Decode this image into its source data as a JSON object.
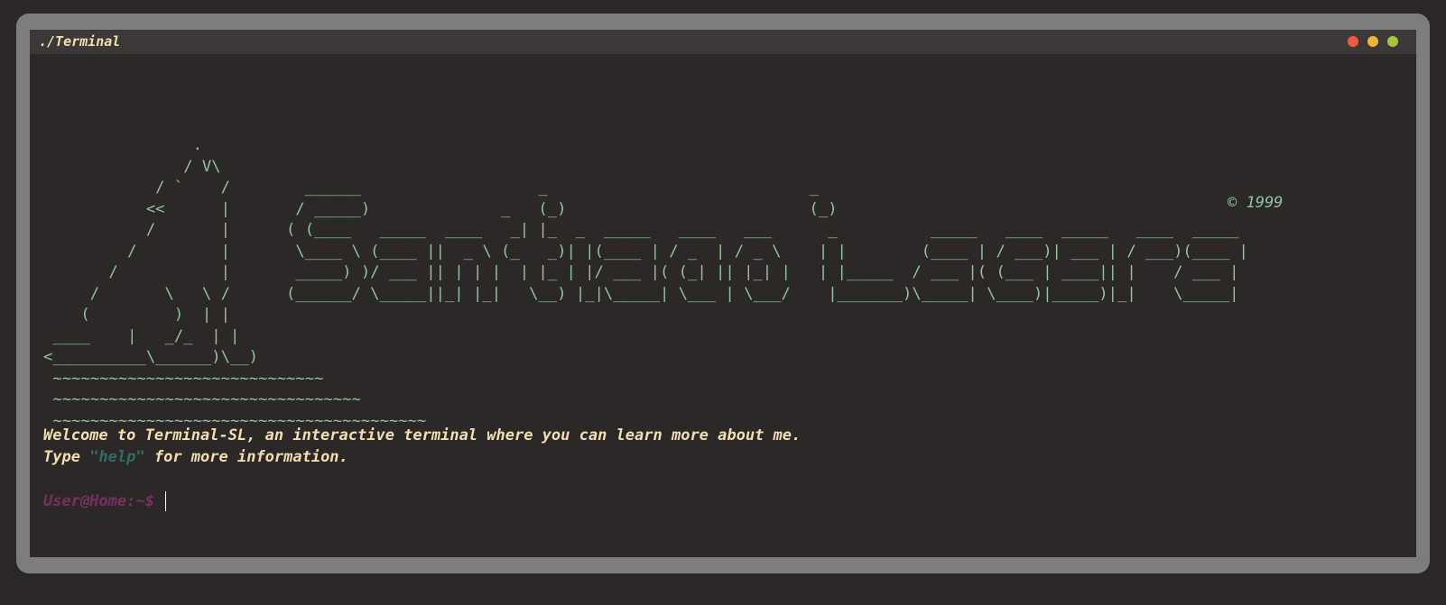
{
  "window": {
    "title": "./Terminal",
    "controls": [
      {
        "name": "close",
        "color": "#f05a40"
      },
      {
        "name": "minimize",
        "color": "#f2b33a"
      },
      {
        "name": "maximize",
        "color": "#a8c43a"
      }
    ]
  },
  "banner": {
    "ascii_art": "                .\n               / V\\\n            / `    /        ______                   _                            _\n           <<      |       / _____)              _   (_)                          (_)\n           /       |      ( (____   _____  ____   _| |_  _  _____   ____   ___      _          _____   ____  _____   ____  _____\n         /         |       \\____ \\ (____ ||  _ \\ (_   _)| |(____ | / _  | / _ \\    | |        (____ | / ___)| ___ | / ___)(____ |\n       /           |       _____) )/ ___ || | | |  | |_ | |/ ___ |( (_| || |_| |   | |_____  / ___ |( (___ | ____|| |    / ___ |\n     /       \\   \\ /      (______/ \\_____||_| |_|   \\__) |_|\\_____| \\___ | \\___/    |_______)\\_____| \\____)|_____)|_|    \\_____|\n    (         )  | |\n ____    |   _/_  | |\n<__________\\______)\\__)\n ~~~~~~~~~~~~~~~~~~~~~~~~~~~~~\n ~~~~~~~~~~~~~~~~~~~~~~~~~~~~~~~~~\n ~~~~~~~~~~~~~~~~~~~~~~~~~~~~~~~~~~~~~~~~",
    "copyright": "© 1999"
  },
  "welcome": {
    "line1": "Welcome to Terminal-SL, an interactive terminal where you can learn more about me.",
    "line2_prefix": "Type ",
    "line2_keyword": "\"help\"",
    "line2_suffix": " for more information."
  },
  "prompt": {
    "text": "User@Home:~$",
    "input_value": ""
  },
  "colors": {
    "accent_text": "#f3deb0",
    "ascii_green": "#8fc4a1",
    "prompt_purple": "#7a2f63",
    "keyword_teal": "#2e6e66"
  }
}
